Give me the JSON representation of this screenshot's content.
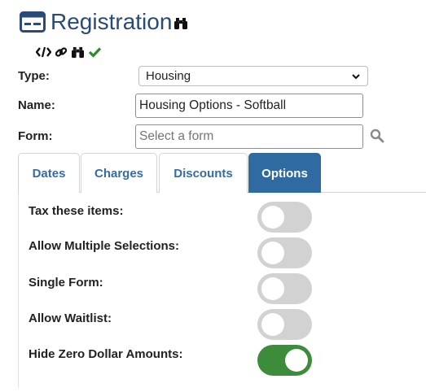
{
  "header": {
    "title": "Registration",
    "icon": "registration-card-icon",
    "title_action_icon": "binoculars-icon"
  },
  "toolbar": {
    "icons": [
      "code-icon",
      "link-icon",
      "binoculars-icon",
      "checkmark-icon"
    ],
    "check_color": "#2e8b2e"
  },
  "form": {
    "type_label": "Type:",
    "type_value": "Housing",
    "name_label": "Name:",
    "name_value": "Housing Options - Softball",
    "form_label": "Form:",
    "form_placeholder": "Select a form"
  },
  "tabs": [
    {
      "label": "Dates",
      "active": false
    },
    {
      "label": "Charges",
      "active": false
    },
    {
      "label": "Discounts",
      "active": false
    },
    {
      "label": "Options",
      "active": true
    }
  ],
  "options": [
    {
      "label": "Tax these items:",
      "on": false
    },
    {
      "label": "Allow Multiple Selections:",
      "on": false
    },
    {
      "label": "Single Form:",
      "on": false
    },
    {
      "label": "Allow Waitlist:",
      "on": false
    },
    {
      "label": "Hide Zero Dollar Amounts:",
      "on": true
    }
  ],
  "colors": {
    "title": "#2a4a78",
    "tab_active": "#2f6aa0",
    "tab_text": "#336ca6",
    "toggle_on": "#3c8c3c",
    "toggle_off": "#d2d2d2"
  }
}
